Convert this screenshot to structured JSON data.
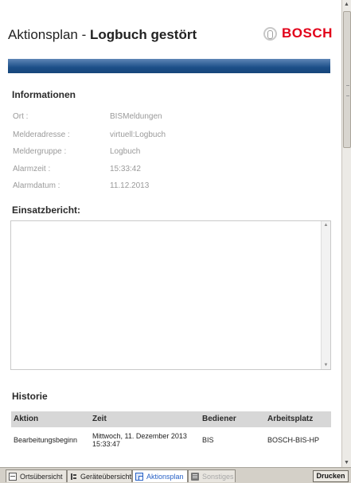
{
  "header": {
    "title_prefix": "Aktionsplan - ",
    "title_bold": "Logbuch gestört",
    "brand": "BOSCH"
  },
  "colors": {
    "brand_red": "#e2001a",
    "band_blue": "#1c4f88",
    "active_tab_text": "#2962c6"
  },
  "info": {
    "title": "Informationen",
    "rows": [
      {
        "label": "Ort :",
        "value": "BISMeldungen"
      },
      {
        "label": "Melderadresse :",
        "value": "virtuell:Logbuch"
      },
      {
        "label": "Meldergruppe :",
        "value": "Logbuch"
      },
      {
        "label": "Alarmzeit :",
        "value": "15:33:42"
      },
      {
        "label": "Alarmdatum :",
        "value": "11.12.2013"
      }
    ]
  },
  "report": {
    "title": "Einsatzbericht:",
    "text": ""
  },
  "history": {
    "title": "Historie",
    "columns": [
      "Aktion",
      "Zeit",
      "Bediener",
      "Arbeitsplatz"
    ],
    "rows": [
      {
        "aktion": "Bearbeitungsbeginn",
        "zeit_line1": "Mittwoch, 11. Dezember 2013",
        "zeit_line2": "15:33:47",
        "bediener": "BIS",
        "arbeitsplatz": "BOSCH-BIS-HP"
      }
    ]
  },
  "tabs": [
    {
      "label": "Ortsübersicht",
      "icon": "map-icon"
    },
    {
      "label": "Geräteübersicht",
      "icon": "tree-icon"
    },
    {
      "label": "Aktionsplan",
      "icon": "plan-icon"
    },
    {
      "label": "Sonstiges",
      "icon": "misc-icon"
    }
  ],
  "print_label": "Drucken"
}
